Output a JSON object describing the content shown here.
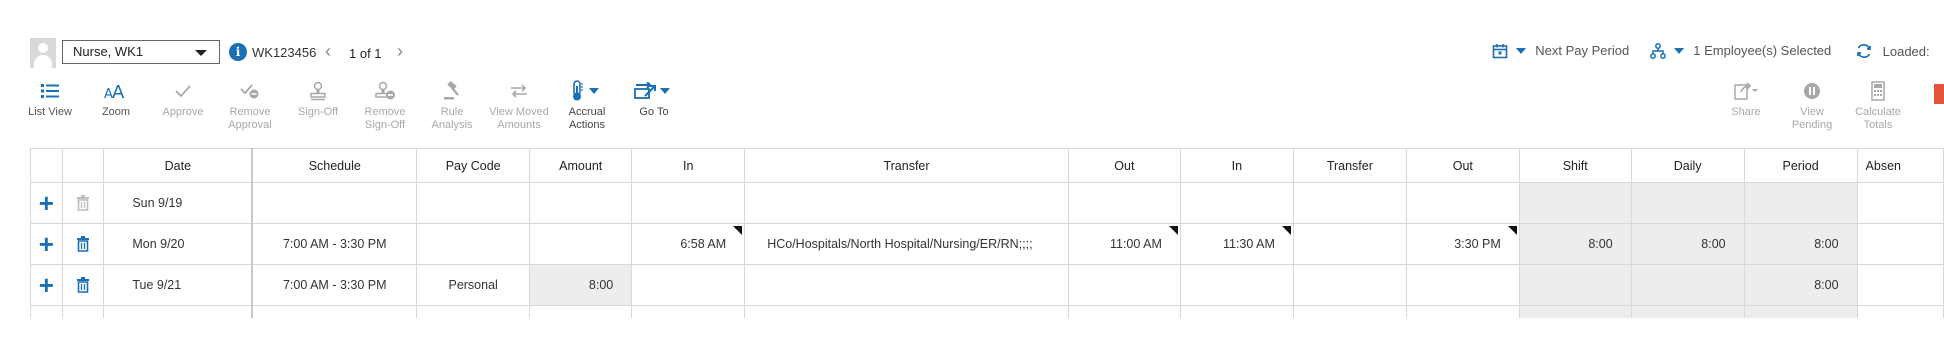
{
  "header": {
    "employee_select": "Nurse, WK1",
    "employee_id": "WK123456",
    "pagination": "1 of 1",
    "period_label": "Next Pay Period",
    "employees_selected": "1 Employee(s) Selected",
    "loaded_label": "Loaded:"
  },
  "toolbar": {
    "list_view": "List View",
    "zoom": "Zoom",
    "approve": "Approve",
    "remove_approval_1": "Remove",
    "remove_approval_2": "Approval",
    "sign_off": "Sign-Off",
    "remove_signoff_1": "Remove",
    "remove_signoff_2": "Sign-Off",
    "rule_analysis_1": "Rule",
    "rule_analysis_2": "Analysis",
    "view_moved_1": "View Moved",
    "view_moved_2": "Amounts",
    "accrual_actions_1": "Accrual",
    "accrual_actions_2": "Actions",
    "go_to": "Go To",
    "share": "Share",
    "view_pending_1": "View",
    "view_pending_2": "Pending",
    "calculate_totals_1": "Calculate",
    "calculate_totals_2": "Totals"
  },
  "columns": [
    "Date",
    "Schedule",
    "Pay Code",
    "Amount",
    "In",
    "Transfer",
    "Out",
    "In",
    "Transfer",
    "Out",
    "Shift",
    "Daily",
    "Period",
    "Absen"
  ],
  "rows": [
    {
      "date": "Sun 9/19",
      "schedule": "",
      "pay_code": "",
      "amount": "",
      "in1": "",
      "transfer1": "",
      "out1": "",
      "in2": "",
      "transfer2": "",
      "out2": "",
      "shift": "",
      "daily": "",
      "period": "",
      "absence": ""
    },
    {
      "date": "Mon 9/20",
      "schedule": "7:00 AM - 3:30 PM",
      "pay_code": "",
      "amount": "",
      "in1": "6:58 AM",
      "transfer1": "HCo/Hospitals/North Hospital/Nursing/ER/RN;;;;",
      "out1": "11:00 AM",
      "in2": "11:30 AM",
      "transfer2": "",
      "out2": "3:30 PM",
      "shift": "8:00",
      "daily": "8:00",
      "period": "8:00",
      "absence": ""
    },
    {
      "date": "Tue 9/21",
      "schedule": "7:00 AM - 3:30 PM",
      "pay_code": "Personal",
      "amount": "8:00",
      "in1": "",
      "transfer1": "",
      "out1": "",
      "in2": "",
      "transfer2": "",
      "out2": "",
      "shift": "",
      "daily": "",
      "period": "8:00",
      "absence": ""
    }
  ],
  "colors": {
    "accent": "#1a6fb5",
    "shade": "#ededed",
    "disabled": "#a8a8a8"
  }
}
